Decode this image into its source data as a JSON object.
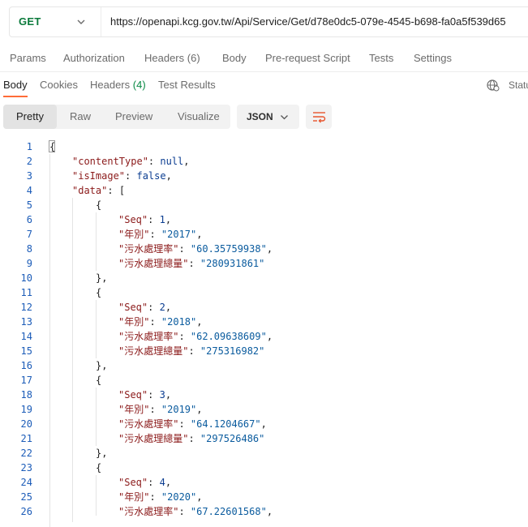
{
  "request": {
    "method": "GET",
    "url": "https://openapi.kcg.gov.tw/Api/Service/Get/d78e0dc5-079e-4545-b698-fa0a5f539d65"
  },
  "request_tabs": [
    {
      "label": "Params"
    },
    {
      "label": "Authorization"
    },
    {
      "label": "Headers",
      "count": "(6)"
    },
    {
      "label": "Body"
    },
    {
      "label": "Pre-request Script"
    },
    {
      "label": "Tests"
    },
    {
      "label": "Settings"
    }
  ],
  "response_tabs": [
    {
      "label": "Body"
    },
    {
      "label": "Cookies"
    },
    {
      "label": "Headers",
      "count": "(4)"
    },
    {
      "label": "Test Results"
    }
  ],
  "status_label": "Statu",
  "view_modes": [
    "Pretty",
    "Raw",
    "Preview",
    "Visualize"
  ],
  "format": "JSON",
  "code": {
    "line_numbers": [
      "1",
      "2",
      "3",
      "4",
      "5",
      "6",
      "7",
      "8",
      "9",
      "10",
      "11",
      "12",
      "13",
      "14",
      "15",
      "16",
      "17",
      "18",
      "19",
      "20",
      "21",
      "22",
      "23",
      "24",
      "25",
      "26"
    ],
    "records": [
      {
        "seq": "1",
        "year": "\"2017\"",
        "rate": "\"60.35759938\"",
        "total": "\"280931861\""
      },
      {
        "seq": "2",
        "year": "\"2018\"",
        "rate": "\"62.09638609\"",
        "total": "\"275316982\""
      },
      {
        "seq": "3",
        "year": "\"2019\"",
        "rate": "\"64.1204667\"",
        "total": "\"297526486\""
      },
      {
        "seq": "4",
        "year": "\"2020\"",
        "rate": "\"67.22601568\""
      }
    ],
    "keys": {
      "contentType": "\"contentType\"",
      "isImage": "\"isImage\"",
      "data": "\"data\"",
      "seq": "\"Seq\"",
      "year": "\"年別\"",
      "rate": "\"污水處理率\"",
      "total": "\"污水處理總量\""
    },
    "values": {
      "null": "null",
      "false": "false"
    },
    "punct": {
      "open_brace": "{",
      "close_brace_comma": "},",
      "open_bracket": "[",
      "colon": ": ",
      "comma": ","
    }
  }
}
